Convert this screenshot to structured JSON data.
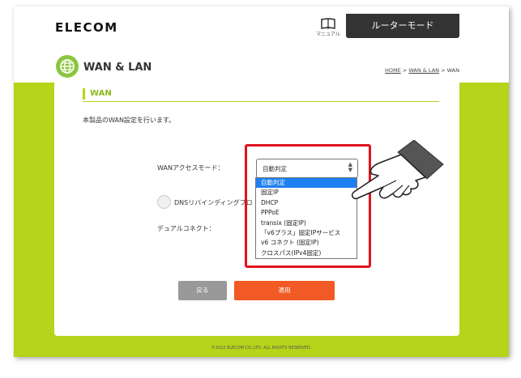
{
  "header": {
    "logo": "ELECOM",
    "manual_label": "マニュアル",
    "router_mode": "ルーターモード"
  },
  "title": {
    "page_title": "WAN & LAN",
    "breadcrumb": {
      "home": "HOME",
      "sep1": " > ",
      "wanlan": "WAN & LAN",
      "sep2": " > ",
      "current": "WAN"
    }
  },
  "section": {
    "title": "WAN",
    "description": "本製品のWAN設定を行います。"
  },
  "form": {
    "access_mode_label": "WANアクセスモード：",
    "access_mode_value": "自動判定",
    "dns_label": "DNSリバインディングプロ",
    "dual_label": "デュアルコネクト：",
    "options": [
      "自動判定",
      "固定IP",
      "DHCP",
      "PPPoE",
      "transix (固定IP)",
      "「v6プラス」固定IPサービス",
      "v6 コネクト (固定IP)",
      "クロスパス(IPv4固定)"
    ],
    "selected_index": 0
  },
  "buttons": {
    "back": "戻る",
    "apply": "適用"
  },
  "footer": "©2022 ELECOM CO.,LTD. ALL RIGHTS RESERVED.",
  "colors": {
    "brand_green": "#b5d41a",
    "apply_orange": "#f15a24",
    "highlight_red": "#e0141e",
    "selected_blue": "#1e7ff0"
  }
}
